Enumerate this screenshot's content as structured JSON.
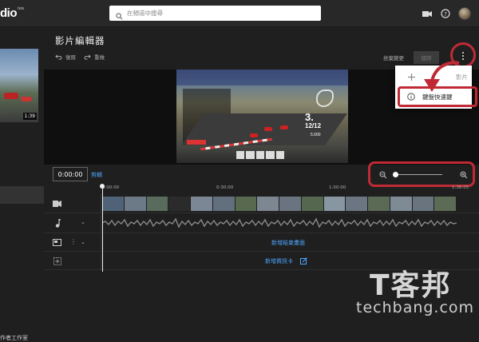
{
  "app": {
    "logo": "dio",
    "logo_sup": "beta"
  },
  "search": {
    "placeholder": "在頻道中搜尋"
  },
  "sidebar": {
    "thumb_duration": "1:39",
    "footer": "作者工作室"
  },
  "editor": {
    "title": "影片編輯器",
    "undo_label": "復原",
    "redo_label": "重做",
    "discard_label": "捨棄變更",
    "save_label": "儲存"
  },
  "menu": {
    "items": [
      {
        "label": "影片",
        "icon": "plus-icon"
      },
      {
        "label": "鍵盤快速鍵",
        "icon": "info-icon"
      }
    ]
  },
  "video": {
    "lap": "3.",
    "position": "12/12",
    "lap_small": "5.000"
  },
  "timebar": {
    "current_time": "0:00:00",
    "cut_label": "剪輯"
  },
  "ruler": {
    "labels": [
      "0:00:00",
      "0:30:00",
      "1:00:00",
      "1:38:05"
    ]
  },
  "tracks": {
    "end_screen": "新增結束畫面",
    "info_card": "新增資訊卡"
  },
  "watermark": {
    "cn": "T客邦",
    "en": "techbang.com"
  },
  "colors": {
    "accent": "#4ea6ff",
    "highlight": "#c02a35",
    "background": "#1f1f1f"
  }
}
